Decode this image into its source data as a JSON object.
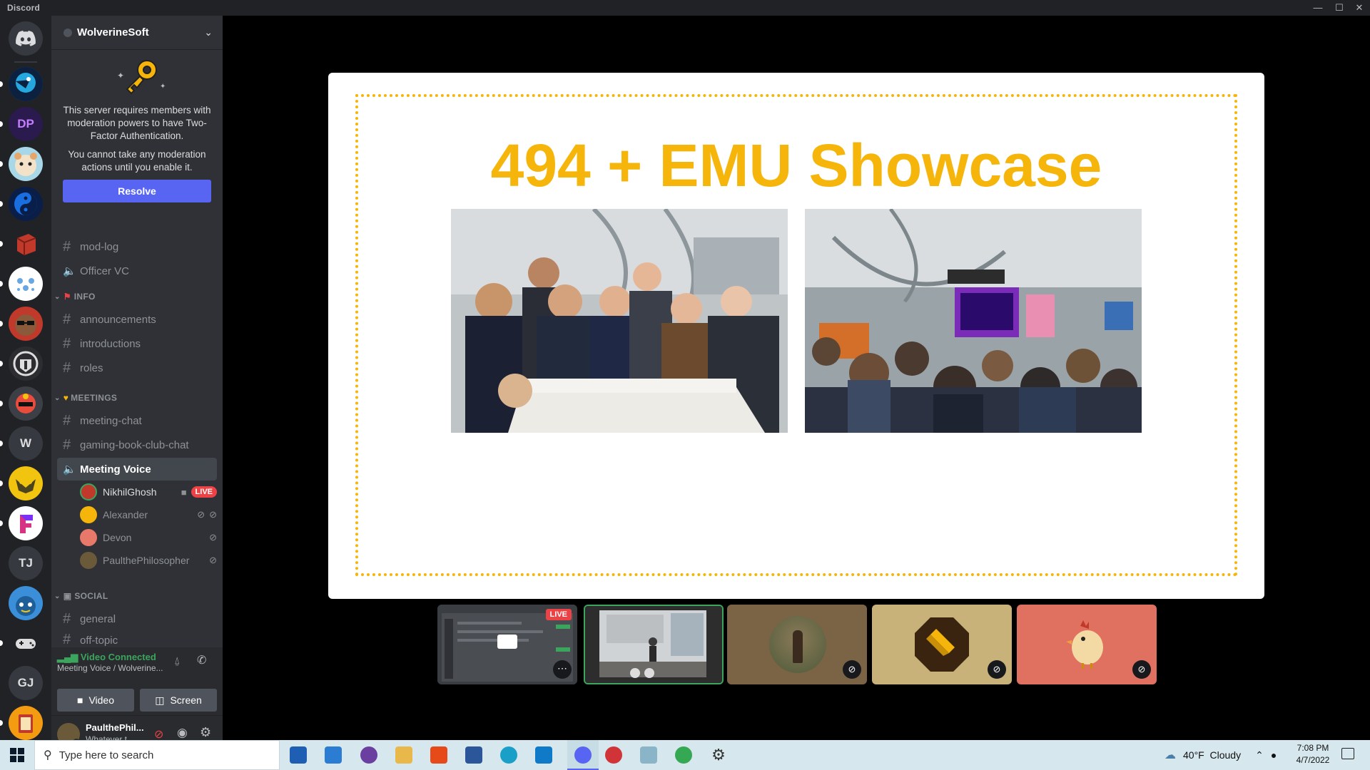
{
  "window": {
    "title": "Discord",
    "controls": [
      "—",
      "☐",
      "✕"
    ]
  },
  "rail": {
    "servers": [
      {
        "name": "discord-home-icon",
        "label": ""
      },
      {
        "name": "server-blue-bird",
        "label": ""
      },
      {
        "name": "server-dp",
        "label": "DP"
      },
      {
        "name": "server-hamster",
        "label": ""
      },
      {
        "name": "server-yinyang",
        "label": ""
      },
      {
        "name": "server-red-cube",
        "label": ""
      },
      {
        "name": "server-pattern",
        "label": ""
      },
      {
        "name": "server-sunglasses",
        "label": ""
      },
      {
        "name": "server-spartan",
        "label": ""
      },
      {
        "name": "server-monster",
        "label": ""
      },
      {
        "name": "server-w",
        "label": "W"
      },
      {
        "name": "server-yellow-mask",
        "label": ""
      },
      {
        "name": "server-purple-f",
        "label": ""
      },
      {
        "name": "server-tj",
        "label": "TJ"
      },
      {
        "name": "server-blue-creature",
        "label": ""
      },
      {
        "name": "server-controller",
        "label": ""
      },
      {
        "name": "server-gj",
        "label": "GJ"
      },
      {
        "name": "server-orange-book",
        "label": ""
      }
    ]
  },
  "sidebar": {
    "server_name": "WolverineSoft",
    "notice": {
      "line1": "This server requires members with moderation powers to have Two-Factor Authentication.",
      "line2": "You cannot take any moderation actions until you enable it.",
      "button": "Resolve"
    },
    "channels_top": [
      {
        "type": "text",
        "label": "mod-log"
      },
      {
        "type": "voice",
        "label": "Officer VC"
      }
    ],
    "info": {
      "label": "INFO",
      "channels": [
        "announcements",
        "introductions",
        "roles"
      ]
    },
    "meetings": {
      "label": "MEETINGS",
      "channels": [
        "meeting-chat",
        "gaming-book-club-chat"
      ],
      "voice": "Meeting Voice",
      "users": [
        {
          "name": "NikhilGhosh",
          "live": "LIVE"
        },
        {
          "name": "Alexander"
        },
        {
          "name": "Devon"
        },
        {
          "name": "PaulthePhilosopher"
        }
      ]
    },
    "social": {
      "label": "SOCIAL",
      "channels": [
        "general",
        "off-topic"
      ]
    },
    "voice_panel": {
      "status": "Video Connected",
      "location": "Meeting Voice / Wolverine...",
      "video_label": "Video",
      "screen_label": "Screen"
    },
    "user_panel": {
      "username": "PaulthePhil...",
      "status": "Whatever t..."
    }
  },
  "stage": {
    "slide_title": "494 + EMU Showcase",
    "tiles": [
      {
        "name": "stream-tile",
        "live": "LIVE"
      },
      {
        "name": "camera-tile"
      },
      {
        "name": "avatar-tile-alexander"
      },
      {
        "name": "avatar-tile-devon"
      },
      {
        "name": "avatar-tile-paul"
      }
    ]
  },
  "taskbar": {
    "search_placeholder": "Type here to search",
    "weather": "40°F  Cloudy",
    "time": "7:08 PM",
    "date": "4/7/2022"
  },
  "colors": {
    "accent": "#5865f2",
    "slide_title": "#f5b50a",
    "live": "#ed4245",
    "connected": "#3ba55d"
  }
}
